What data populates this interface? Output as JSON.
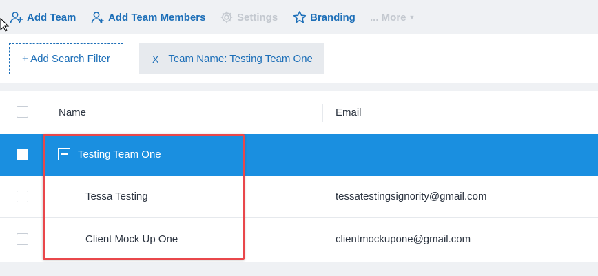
{
  "toolbar": {
    "add_team": "Add Team",
    "add_team_members": "Add Team Members",
    "settings": "Settings",
    "branding": "Branding",
    "more": "... More"
  },
  "filters": {
    "add_filter_label": "+ Add Search Filter",
    "active_filter": {
      "remove": "X",
      "label": "Team Name:  Testing Team One"
    }
  },
  "table": {
    "columns": {
      "name": "Name",
      "email": "Email"
    },
    "team": {
      "name": "Testing Team One"
    },
    "members": [
      {
        "name": "Tessa Testing",
        "email": "tessatestingsignority@gmail.com"
      },
      {
        "name": "Client Mock Up One",
        "email": "clientmockupone@gmail.com"
      }
    ]
  },
  "colors": {
    "accent": "#1d6fb8",
    "selected_row": "#1a8fe0",
    "highlight_border": "#e9474b",
    "disabled": "#c3c8cf"
  },
  "icons": [
    "add-team-icon",
    "add-member-icon",
    "gear-icon",
    "star-icon",
    "chevron-down-icon",
    "minus-icon",
    "close-icon",
    "mouse-cursor-icon"
  ]
}
